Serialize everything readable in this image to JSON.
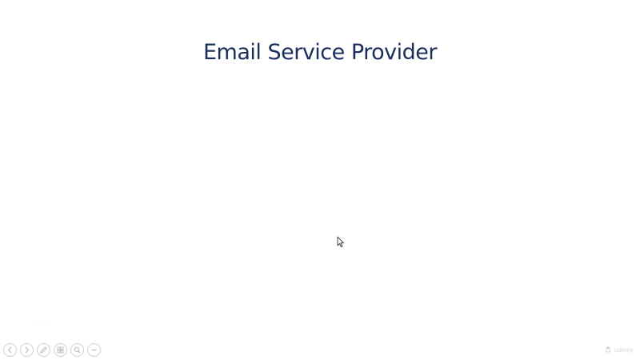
{
  "slide": {
    "title": "Email Service Provider"
  },
  "toolbar": {
    "buttons": [
      {
        "icon": "previous-icon"
      },
      {
        "icon": "next-icon"
      },
      {
        "icon": "pen-icon"
      },
      {
        "icon": "slides-overview-icon"
      },
      {
        "icon": "zoom-icon"
      },
      {
        "icon": "more-options-icon"
      }
    ]
  },
  "watermark": {
    "text": "udemy"
  },
  "colors": {
    "title": "#1b2f5c",
    "background": "#ffffff",
    "toolbar_outline": "#d2d2d2"
  }
}
